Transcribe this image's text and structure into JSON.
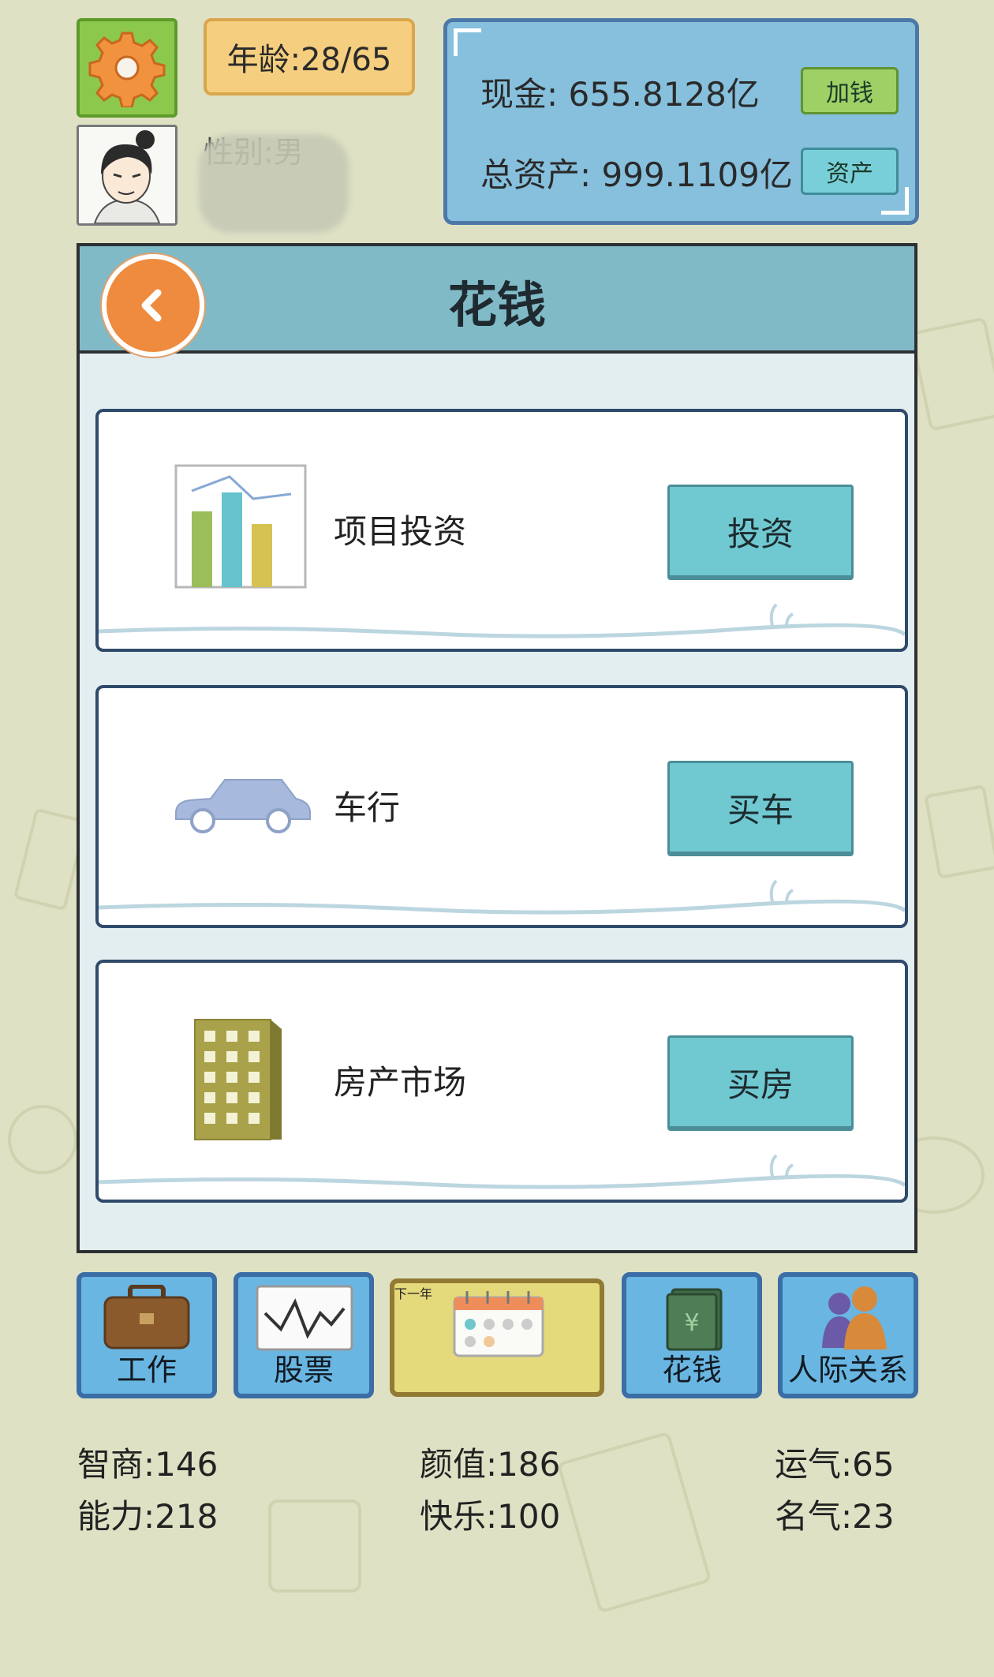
{
  "header": {
    "age_text": "年龄:28/65",
    "gender_text": "性别:男",
    "cash_text": "现金: 655.8128亿",
    "add_money_label": "加钱",
    "assets_text": "总资产: 999.1109亿",
    "assets_label": "资产"
  },
  "panel": {
    "title": "花钱",
    "cards": [
      {
        "label": "项目投资",
        "button": "投资",
        "icon": "bar-chart-icon"
      },
      {
        "label": "车行",
        "button": "买车",
        "icon": "car-icon"
      },
      {
        "label": "房产市场",
        "button": "买房",
        "icon": "building-icon"
      }
    ]
  },
  "nav": [
    {
      "label": "工作",
      "icon": "briefcase-icon"
    },
    {
      "label": "股票",
      "icon": "stock-chart-icon"
    },
    {
      "label": "下一年",
      "icon": "calendar-icon"
    },
    {
      "label": "花钱",
      "icon": "money-icon"
    },
    {
      "label": "人际关系",
      "icon": "people-icon"
    }
  ],
  "stats": {
    "iq": "智商:146",
    "looks": "颜值:186",
    "luck": "运气:65",
    "ability": "能力:218",
    "happiness": "快乐:100",
    "fame": "名气:23"
  },
  "colors": {
    "background": "#dfe1c5",
    "header_blue": "#80bac7",
    "button_teal": "#70c8d1",
    "back_orange": "#ee8b3e"
  }
}
